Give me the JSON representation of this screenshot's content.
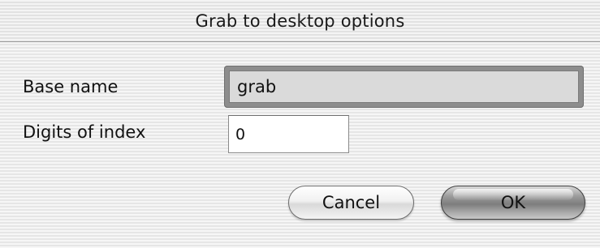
{
  "window": {
    "title": "Grab to desktop options"
  },
  "form": {
    "base_name": {
      "label": "Base name",
      "value": "grab"
    },
    "digits_of_index": {
      "label": "Digits of index",
      "value": "0"
    }
  },
  "buttons": {
    "cancel_label": "Cancel",
    "ok_label": "OK"
  }
}
